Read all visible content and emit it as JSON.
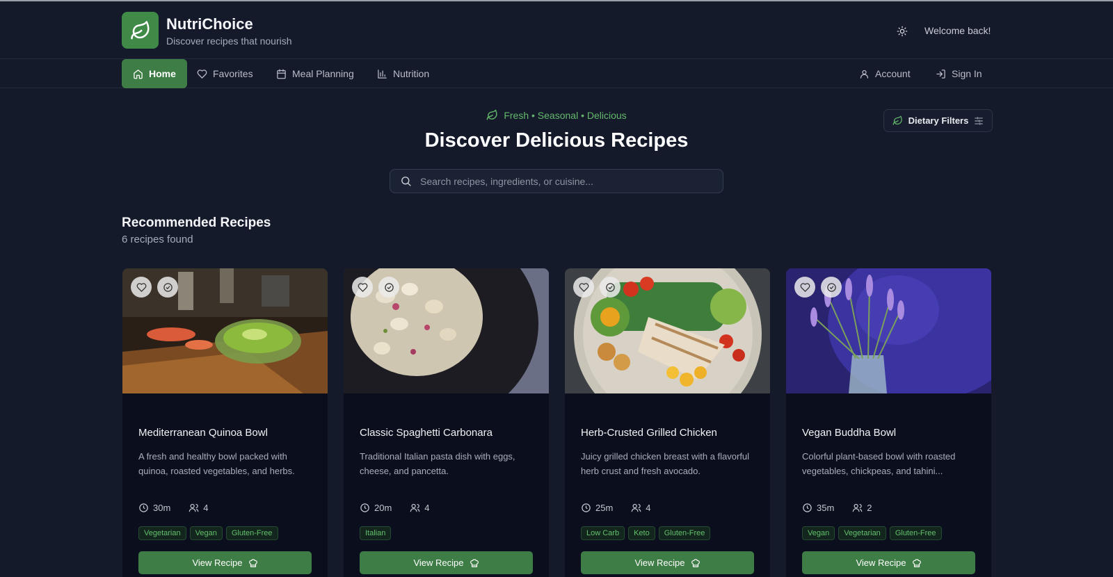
{
  "header": {
    "app_title": "NutriChoice",
    "app_subtitle": "Discover recipes that nourish",
    "welcome": "Welcome back!",
    "brand_color": "#3f8a47"
  },
  "nav": {
    "items": [
      {
        "label": "Home",
        "icon": "home-icon",
        "active": true
      },
      {
        "label": "Favorites",
        "icon": "heart-icon",
        "active": false
      },
      {
        "label": "Meal Planning",
        "icon": "calendar-icon",
        "active": false
      },
      {
        "label": "Nutrition",
        "icon": "bar-chart-icon",
        "active": false
      }
    ],
    "account_label": "Account",
    "signin_label": "Sign In"
  },
  "hero": {
    "tagline": "Fresh • Seasonal • Delicious",
    "title": "Discover Delicious Recipes",
    "search_placeholder": "Search recipes, ingredients, or cuisine...",
    "filters_label": "Dietary Filters"
  },
  "section": {
    "title": "Recommended Recipes",
    "count": "6 recipes found"
  },
  "recipes": [
    {
      "title": "Mediterranean Quinoa Bowl",
      "description": "A fresh and healthy bowl packed with quinoa, roasted vegetables, and herbs.",
      "time": "30m",
      "servings": "4",
      "tags": [
        "Vegetarian",
        "Vegan",
        "Gluten-Free"
      ],
      "button": "View Recipe"
    },
    {
      "title": "Classic Spaghetti Carbonara",
      "description": "Traditional Italian pasta dish with eggs, cheese, and pancetta.",
      "time": "20m",
      "servings": "4",
      "tags": [
        "Italian"
      ],
      "button": "View Recipe"
    },
    {
      "title": "Herb-Crusted Grilled Chicken",
      "description": "Juicy grilled chicken breast with a flavorful herb crust and fresh avocado.",
      "time": "25m",
      "servings": "4",
      "tags": [
        "Low Carb",
        "Keto",
        "Gluten-Free"
      ],
      "button": "View Recipe"
    },
    {
      "title": "Vegan Buddha Bowl",
      "description": "Colorful plant-based bowl with roasted vegetables, chickpeas, and tahini...",
      "time": "35m",
      "servings": "2",
      "tags": [
        "Vegan",
        "Vegetarian",
        "Gluten-Free"
      ],
      "button": "View Recipe"
    }
  ]
}
